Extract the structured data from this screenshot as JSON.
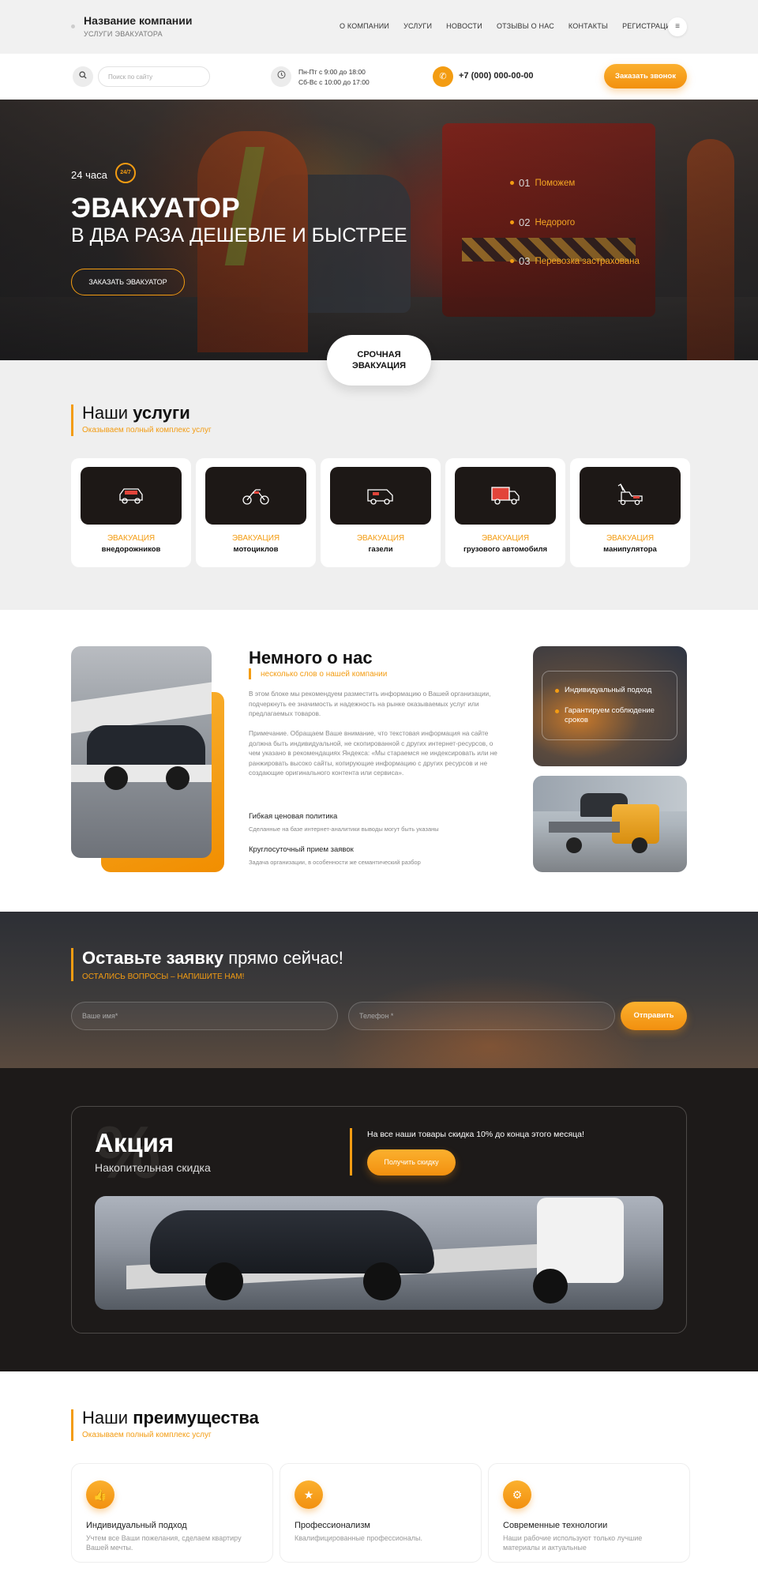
{
  "header": {
    "company_name": "Название компании",
    "company_sub": "УСЛУГИ ЭВАКУАТОРА",
    "nav": [
      "О КОМПАНИИ",
      "УСЛУГИ",
      "НОВОСТИ",
      "ОТЗЫВЫ О НАС",
      "КОНТАКТЫ",
      "РЕГИСТРАЦИЯ"
    ],
    "search_placeholder": "Поиск по сайту",
    "hours_line1": "Пн-Пт с 9:00 до 18:00",
    "hours_line2": "Сб-Вс с 10:00 до 17:00",
    "phone": "+7 (000) 000-00-00",
    "call_button": "Заказать звонок"
  },
  "hero": {
    "label_24": "24 часа",
    "badge": "24/7",
    "title": "ЭВАКУАТОР",
    "subtitle": "В ДВА РАЗА ДЕШЕВЛЕ И БЫСТРЕЕ",
    "button": "ЗАКАЗАТЬ ЭВАКУАТОР",
    "features": [
      {
        "num": "01",
        "label": "Поможем"
      },
      {
        "num": "02",
        "label": "Недорого"
      },
      {
        "num": "03",
        "label": "Перевозка застрахована"
      }
    ],
    "urgent_line1": "СРОЧНАЯ",
    "urgent_line2": "ЭВАКУАЦИЯ"
  },
  "services": {
    "title_light": "Наши",
    "title_bold": "услуги",
    "subtitle": "Оказываем полный комплекс услуг",
    "cards": [
      {
        "top": "ЭВАКУАЦИЯ",
        "bottom": "внедорожников",
        "icon": "suv-icon"
      },
      {
        "top": "ЭВАКУАЦИЯ",
        "bottom": "мотоциклов",
        "icon": "atv-icon"
      },
      {
        "top": "ЭВАКУАЦИЯ",
        "bottom": "газели",
        "icon": "van-icon"
      },
      {
        "top": "ЭВАКУАЦИЯ",
        "bottom": "грузового автомобиля",
        "icon": "truck-icon"
      },
      {
        "top": "ЭВАКУАЦИЯ",
        "bottom": "манипулятора",
        "icon": "crane-icon"
      }
    ]
  },
  "about": {
    "title": "Немного о нас",
    "subtitle": "несколько слов о нашей компании",
    "p1": "В этом блоке мы рекомендуем разместить информацию о Вашей организации, подчеркнуть ее значимость и надежность на рынке оказываемых услуг или предлагаемых товаров.",
    "p2": "Примечание. Обращаем Ваше внимание, что текстовая информация на сайте должна быть индивидуальной, не скопированной с других интернет-ресурсов, о чем указано в рекомендациях Яндекса: «Мы стараемся не индексировать или не ранжировать высоко сайты, копирующие информацию с других ресурсов и не создающие оригинального контента или сервиса».",
    "f1_title": "Гибкая ценовая политика",
    "f1_desc": "Сделанные на базе интернет-аналитики выводы могут быть указаны",
    "f2_title": "Круглосуточный прием заявок",
    "f2_desc": "Задача организации, в особенности же семантический разбор",
    "card_item1": "Индивидуальный подход",
    "card_item2": "Гарантируем соблюдение сроков"
  },
  "form": {
    "title_bold": "Оставьте заявку",
    "title_light": "прямо сейчас!",
    "subtitle": "ОСТАЛИСЬ ВОПРОСЫ – НАПИШИТЕ НАМ!",
    "name_placeholder": "Ваше имя*",
    "phone_placeholder": "Телефон *",
    "submit": "Отправить"
  },
  "promo": {
    "percent": "%",
    "title": "Акция",
    "subtitle": "Накопительная скидка",
    "text": "На все наши товары скидка 10% до конца этого месяца!",
    "button": "Получить скидку"
  },
  "advantages": {
    "title_light": "Наши",
    "title_bold": "преимущества",
    "subtitle": "Оказываем полный комплекс услуг",
    "items": [
      {
        "title": "Индивидуальный подход",
        "desc": "Учтем все Ваши пожелания, сделаем квартиру Вашей мечты."
      },
      {
        "title": "Профессионализм",
        "desc": "Квалифицированные профессионалы."
      },
      {
        "title": "Современные технологии",
        "desc": "Наши рабочие используют только лучшие материалы и актуальные"
      }
    ]
  },
  "colors": {
    "accent": "#f39c12",
    "dark": "#1d1a19"
  }
}
